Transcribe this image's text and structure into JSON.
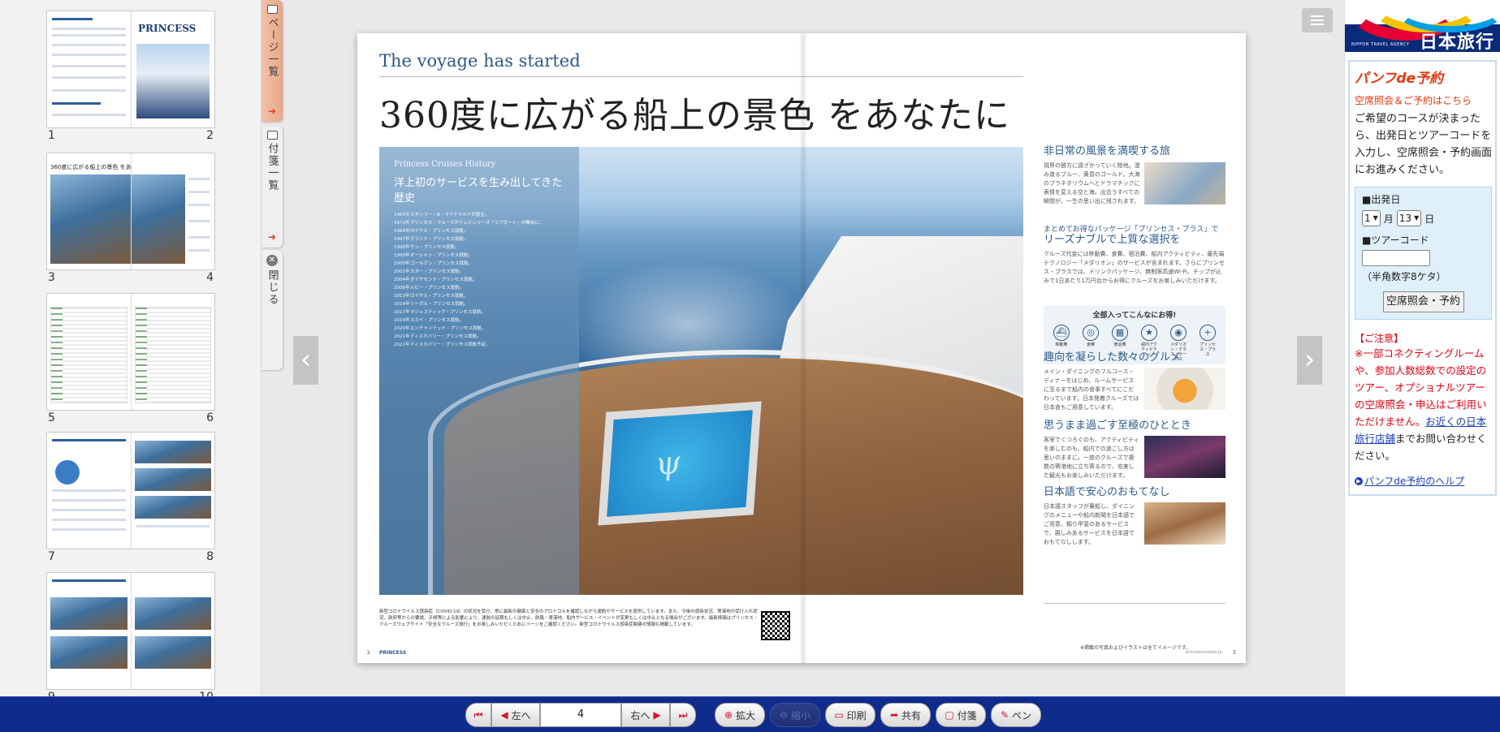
{
  "thumbnails": {
    "pairs": [
      {
        "left": "1",
        "right": "2"
      },
      {
        "left": "3",
        "right": "4"
      },
      {
        "left": "5",
        "right": "6"
      },
      {
        "left": "7",
        "right": "8"
      },
      {
        "left": "9",
        "right": "10"
      }
    ],
    "thumb1_right_brand": "PRINCESS",
    "thumb2_title": "360度に広がる船上の景色 をあなたに"
  },
  "side_tabs": {
    "pages_label": "ページ一覧",
    "notes_label": "付箋一覧",
    "close_label": "閉じる",
    "arrow": "➜"
  },
  "viewer": {
    "nav_left": "‹",
    "nav_right": "›"
  },
  "magazine": {
    "eyebrow": "The voyage has started",
    "title": "360度に広がる船上の景色 をあなたに",
    "history": {
      "label": "Princess Cruises History",
      "title": "洋上初のサービスを生み出してきた歴史",
      "rows": [
        {
          "year": "1965年",
          "text": "スタンリー・B・マクドナルドが創立。"
        },
        {
          "year": "1972年",
          "text": "プリンセス・クルーズがテレビシリーズ「ラブボート」の舞台に。"
        },
        {
          "year": "1984年",
          "text": "ロイヤル・プリンセス就航。"
        },
        {
          "year": "1997年",
          "text": "グランド・プリンセス就航。"
        },
        {
          "year": "1998年",
          "text": "サン・プリンセス就航。"
        },
        {
          "year": "1999年",
          "text": "オーシャン・プリンセス就航。"
        },
        {
          "year": "2000年",
          "text": "ゴールデン・プリンセス就航。"
        },
        {
          "year": "2001年",
          "text": "スター・プリンセス就航。"
        },
        {
          "year": "2004年",
          "text": "ダイヤモンド・プリンセス就航。"
        },
        {
          "year": "2008年",
          "text": "ルビー・プリンセス就航。"
        },
        {
          "year": "2013年",
          "text": "ロイヤル・プリンセス就航。"
        },
        {
          "year": "2014年",
          "text": "リーガル・プリンセス就航。"
        },
        {
          "year": "2017年",
          "text": "マジェスティック・プリンセス就航。"
        },
        {
          "year": "2019年",
          "text": "スカイ・プリンセス就航。"
        },
        {
          "year": "2020年",
          "text": "エンチャンテッド・プリンセス就航。"
        },
        {
          "year": "2021年",
          "text": "ディスカバリー・プリンセス就航。"
        },
        {
          "year": "2022年",
          "text": "ディスカバリー・プリンセス就航予定。"
        }
      ]
    },
    "sections": [
      {
        "heading": "非日常の風景を満喫する旅",
        "body": "視界の彼方に遠ざかっていく陸地。澄み渡るブルー、黄昏のゴールド。大海のプラネタリウムへとドラマチックに表情を変える空と海。出合うすべての瞬間が、一生の思い出に残されます。"
      },
      {
        "subheading": "まとめてお得なパッケージ「プリンセス・プラス」で",
        "heading": "リーズナブルで上質な選択を",
        "body": "クルーズ代金には移動費、食費、宿泊費、船内アクティビティ、最先端テクノロジー「メダリオン」のサービスが含まれます。さらにプリンセス・プラスでは、ドリンクパッケージ、無制限高速Wi-Fi、チップが込みで1日あたり1万円台からお得にクルーズをお楽しみいただけます。"
      },
      {
        "heading": "趣向を凝らした数々のグルメ",
        "body": "メイン・ダイニングのフルコース・ディナーをはじめ、ルームサービスに至るまで船内の食事すべてにこだわっています。日本発着クルーズでは日本食もご用意しています。"
      },
      {
        "heading": "思うまま過ごす至極のひととき",
        "body": "客室でくつろぐのも、アクティビティを楽しむのも、船内での過ごし方は思いのままに。一度のクルーズで複数の寄港地に立ち寄るので、充実した観光もお楽しみいただけます。"
      },
      {
        "heading": "日本語で安心のおもてなし",
        "body": "日本語スタッフが乗船し、ダイニングのメニューや船内新聞を日本語でご用意。頼り甲斐のあるサービスで、親しみあるサービスを日本語でおもてなしします。"
      }
    ],
    "package_box": {
      "title": "全部入ってこんなにお得!",
      "items": [
        "移動費",
        "食費",
        "宿泊費",
        "船内アクティビティ",
        "メダリオン・クラス・サービス",
        "プリンセス・プラス"
      ]
    },
    "footnotes": "新型コロナウイルス感染症（COVID-19）の状況を受け、常に最新の健康と安全のプロトコルを確認しながら運航やサービスを提供しています。また、今後の感染状況、寄港地の受け入れ状況、政府等からの要請、天候等による影響により、運航の延期もしくは中止、航路・寄港地、船内サービス・イベントが変更もしくは中止となる場合がございます。最新情報はプリンセス・クルーズウェブサイト「安全なクルーズ旅行」をお楽しみいただくためにページをご確認ください。新型コロナウイルス感染症関連の情報も掲載しています。",
    "photo_note": "※掲載の写真およびイラストは全てイメージです。",
    "brand_footer": "PRINCESS",
    "page_left": "2",
    "page_right": "3",
    "site_url": "princesscruises.jp"
  },
  "right_panel": {
    "brand_sub": "NIPPON TRAVEL AGENCY",
    "brand": "日本旅行",
    "title": "パンフde予約",
    "subtitle": "空席照会＆ご予約はこちら",
    "description": "ご希望のコースが決まったら、出発日とツアーコードを入力し、空席照会・予約画面にお進みください。",
    "form": {
      "departure_label": "■出発日",
      "month_value": "1",
      "month_unit": "月",
      "day_value": "13",
      "day_unit": "日",
      "tour_code_label": "■ツアーコード",
      "tour_code_value": "",
      "tour_code_hint": "（半角数字8ケタ）",
      "submit_label": "空席照会・予約"
    },
    "caution_heading": "【ご注意】",
    "caution_text": "※一部コネクティングルームや、参加人数総数での設定のツアー、オプショナルツアーの空席照会・申込はご利用いただけません。",
    "caution_link": "お近くの日本旅行店舗",
    "caution_tail": "までお問い合わせください。",
    "help_link": "パンフde予約のヘルプ"
  },
  "toolbar": {
    "first_icon": "first-page-icon",
    "prev_label": "左へ",
    "page_value": "4",
    "next_label": "右へ",
    "last_icon": "last-page-icon",
    "zoom_in_label": "拡大",
    "zoom_out_label": "縮小",
    "print_label": "印刷",
    "share_label": "共有",
    "note_label": "付箋",
    "pen_label": "ペン"
  },
  "colors": {
    "toolbar_bg": "#0f2b8c",
    "accent_red": "#e60012",
    "heading_blue": "#2a5a8a",
    "link_blue": "#1a3fb8"
  }
}
